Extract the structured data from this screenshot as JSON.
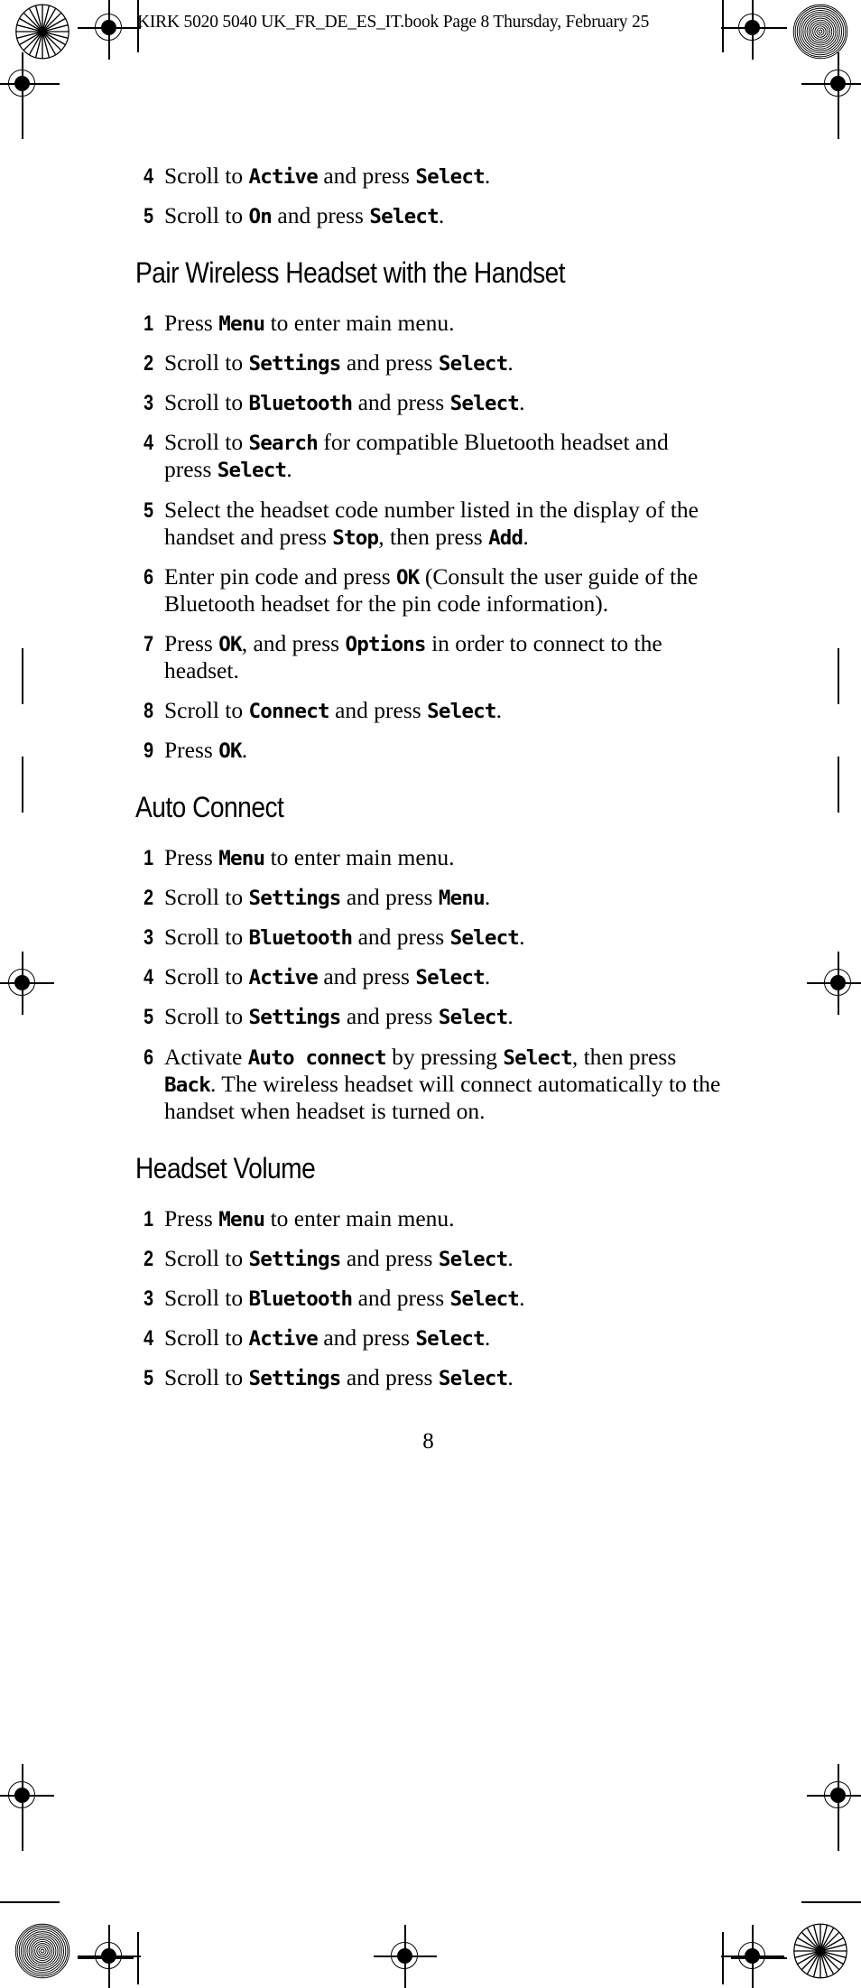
{
  "header": {
    "file_line": "KIRK 5020 5040 UK_FR_DE_ES_IT.book  Page 8  Thursday, February 25"
  },
  "page": {
    "number": "8"
  },
  "sections": [
    {
      "heading": null,
      "heading_visible": false,
      "steps": [
        {
          "num": "4",
          "parts": [
            {
              "t": "Scroll to ",
              "ui": false
            },
            {
              "t": "Active",
              "ui": true
            },
            {
              "t": " and press ",
              "ui": false
            },
            {
              "t": "Select",
              "ui": true
            },
            {
              "t": ".",
              "ui": false
            }
          ]
        },
        {
          "num": "5",
          "parts": [
            {
              "t": "Scroll to ",
              "ui": false
            },
            {
              "t": "On",
              "ui": true
            },
            {
              "t": " and press ",
              "ui": false
            },
            {
              "t": "Select",
              "ui": true
            },
            {
              "t": ".",
              "ui": false
            }
          ]
        }
      ]
    },
    {
      "heading": "Pair Wireless Headset with the Handset",
      "heading_visible": true,
      "steps": [
        {
          "num": "1",
          "parts": [
            {
              "t": "Press ",
              "ui": false
            },
            {
              "t": "Menu",
              "ui": true
            },
            {
              "t": " to enter main menu.",
              "ui": false
            }
          ]
        },
        {
          "num": "2",
          "parts": [
            {
              "t": "Scroll to ",
              "ui": false
            },
            {
              "t": "Settings",
              "ui": true
            },
            {
              "t": " and press ",
              "ui": false
            },
            {
              "t": "Select",
              "ui": true
            },
            {
              "t": ".",
              "ui": false
            }
          ]
        },
        {
          "num": "3",
          "parts": [
            {
              "t": "Scroll to ",
              "ui": false
            },
            {
              "t": "Bluetooth",
              "ui": true
            },
            {
              "t": " and press ",
              "ui": false
            },
            {
              "t": "Select",
              "ui": true
            },
            {
              "t": ".",
              "ui": false
            }
          ]
        },
        {
          "num": "4",
          "parts": [
            {
              "t": "Scroll to ",
              "ui": false
            },
            {
              "t": "Search",
              "ui": true
            },
            {
              "t": " for compatible Bluetooth headset and press ",
              "ui": false
            },
            {
              "t": "Select",
              "ui": true
            },
            {
              "t": ".",
              "ui": false
            }
          ]
        },
        {
          "num": "5",
          "parts": [
            {
              "t": "Select the headset code number listed in the display of the handset and press ",
              "ui": false
            },
            {
              "t": "Stop",
              "ui": true
            },
            {
              "t": ", then press ",
              "ui": false
            },
            {
              "t": "Add",
              "ui": true
            },
            {
              "t": ".",
              "ui": false
            }
          ]
        },
        {
          "num": "6",
          "parts": [
            {
              "t": "Enter pin code and press ",
              "ui": false
            },
            {
              "t": "OK",
              "ui": true
            },
            {
              "t": " (Consult the user guide of the Bluetooth headset for the pin code information).",
              "ui": false
            }
          ]
        },
        {
          "num": "7",
          "parts": [
            {
              "t": "Press ",
              "ui": false
            },
            {
              "t": "OK",
              "ui": true
            },
            {
              "t": ", and press ",
              "ui": false
            },
            {
              "t": "Options",
              "ui": true
            },
            {
              "t": " in order to connect to the headset.",
              "ui": false
            }
          ]
        },
        {
          "num": "8",
          "parts": [
            {
              "t": "Scroll to ",
              "ui": false
            },
            {
              "t": "Connect",
              "ui": true
            },
            {
              "t": " and press ",
              "ui": false
            },
            {
              "t": "Select",
              "ui": true
            },
            {
              "t": ".",
              "ui": false
            }
          ]
        },
        {
          "num": "9",
          "parts": [
            {
              "t": "Press ",
              "ui": false
            },
            {
              "t": "OK",
              "ui": true
            },
            {
              "t": ".",
              "ui": false
            }
          ]
        }
      ]
    },
    {
      "heading": "Auto Connect",
      "heading_visible": true,
      "steps": [
        {
          "num": "1",
          "parts": [
            {
              "t": "Press ",
              "ui": false
            },
            {
              "t": "Menu",
              "ui": true
            },
            {
              "t": " to enter main menu.",
              "ui": false
            }
          ]
        },
        {
          "num": "2",
          "parts": [
            {
              "t": "Scroll to ",
              "ui": false
            },
            {
              "t": "Settings",
              "ui": true
            },
            {
              "t": " and press ",
              "ui": false
            },
            {
              "t": "Menu",
              "ui": true
            },
            {
              "t": ".",
              "ui": false
            }
          ]
        },
        {
          "num": "3",
          "parts": [
            {
              "t": "Scroll to ",
              "ui": false
            },
            {
              "t": "Bluetooth",
              "ui": true
            },
            {
              "t": " and press ",
              "ui": false
            },
            {
              "t": "Select",
              "ui": true
            },
            {
              "t": ".",
              "ui": false
            }
          ]
        },
        {
          "num": "4",
          "parts": [
            {
              "t": "Scroll to ",
              "ui": false
            },
            {
              "t": "Active",
              "ui": true
            },
            {
              "t": " and press ",
              "ui": false
            },
            {
              "t": "Select",
              "ui": true
            },
            {
              "t": ".",
              "ui": false
            }
          ]
        },
        {
          "num": "5",
          "parts": [
            {
              "t": "Scroll to ",
              "ui": false
            },
            {
              "t": "Settings",
              "ui": true
            },
            {
              "t": " and press ",
              "ui": false
            },
            {
              "t": "Select",
              "ui": true
            },
            {
              "t": ".",
              "ui": false
            }
          ]
        },
        {
          "num": "6",
          "parts": [
            {
              "t": "Activate ",
              "ui": false
            },
            {
              "t": "Auto connect",
              "ui": true
            },
            {
              "t": " by pressing ",
              "ui": false
            },
            {
              "t": "Select",
              "ui": true
            },
            {
              "t": ", then press ",
              "ui": false
            },
            {
              "t": "Back",
              "ui": true
            },
            {
              "t": ". The wireless headset will connect automatically to the handset when headset is turned on.",
              "ui": false
            }
          ]
        }
      ]
    },
    {
      "heading": "Headset Volume",
      "heading_visible": true,
      "steps": [
        {
          "num": "1",
          "parts": [
            {
              "t": "Press ",
              "ui": false
            },
            {
              "t": "Menu",
              "ui": true
            },
            {
              "t": " to enter main menu.",
              "ui": false
            }
          ]
        },
        {
          "num": "2",
          "parts": [
            {
              "t": "Scroll to ",
              "ui": false
            },
            {
              "t": "Settings",
              "ui": true
            },
            {
              "t": " and press ",
              "ui": false
            },
            {
              "t": "Select",
              "ui": true
            },
            {
              "t": ".",
              "ui": false
            }
          ]
        },
        {
          "num": "3",
          "parts": [
            {
              "t": "Scroll to ",
              "ui": false
            },
            {
              "t": "Bluetooth",
              "ui": true
            },
            {
              "t": " and press ",
              "ui": false
            },
            {
              "t": "Select",
              "ui": true
            },
            {
              "t": ".",
              "ui": false
            }
          ]
        },
        {
          "num": "4",
          "parts": [
            {
              "t": "Scroll to ",
              "ui": false
            },
            {
              "t": "Active",
              "ui": true
            },
            {
              "t": " and press ",
              "ui": false
            },
            {
              "t": "Select",
              "ui": true
            },
            {
              "t": ".",
              "ui": false
            }
          ]
        },
        {
          "num": "5",
          "parts": [
            {
              "t": "Scroll to ",
              "ui": false
            },
            {
              "t": "Settings",
              "ui": true
            },
            {
              "t": " and press ",
              "ui": false
            },
            {
              "t": "Select",
              "ui": true
            },
            {
              "t": ".",
              "ui": false
            }
          ]
        }
      ]
    }
  ],
  "print_marks": {
    "star_target": "radial-star-target",
    "moire_target": "concentric-ring-target",
    "registration": "registration-crosshair-target"
  }
}
